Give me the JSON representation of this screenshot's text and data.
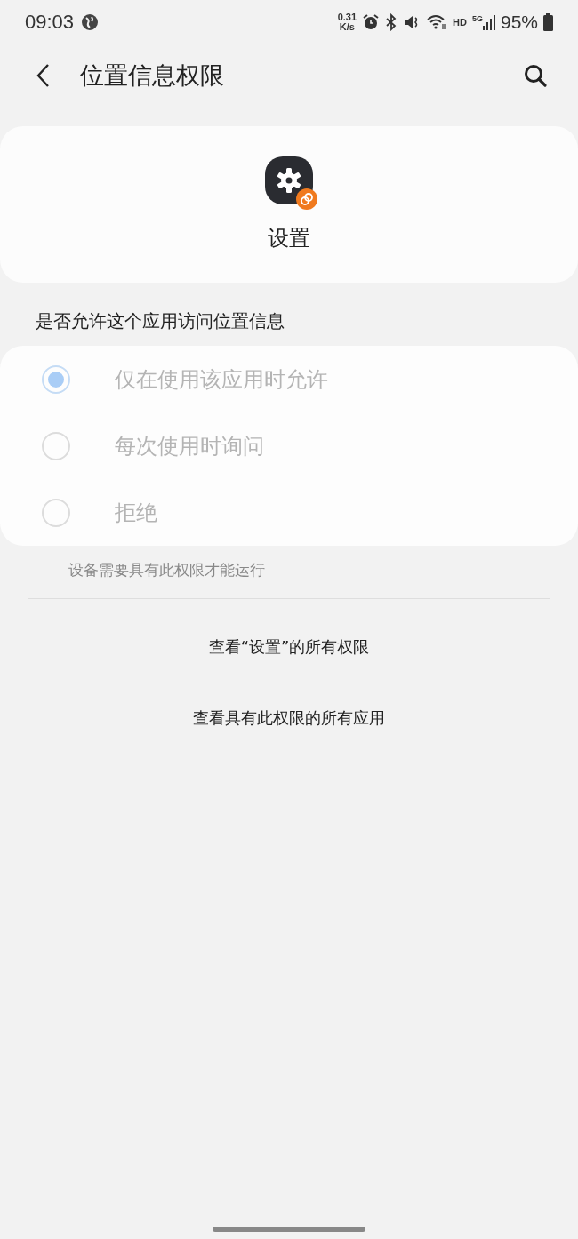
{
  "status_bar": {
    "time": "09:03",
    "net_speed_value": "0.31",
    "net_speed_unit": "K/s",
    "hd": "HD",
    "network": "5G",
    "battery": "95%"
  },
  "header": {
    "title": "位置信息权限"
  },
  "app": {
    "name": "设置"
  },
  "question": "是否允许这个应用访问位置信息",
  "options": [
    {
      "label": "仅在使用该应用时允许",
      "selected": true,
      "disabled": true
    },
    {
      "label": "每次使用时询问",
      "selected": false,
      "disabled": true
    },
    {
      "label": "拒绝",
      "selected": false,
      "disabled": true
    }
  ],
  "note": "设备需要具有此权限才能运行",
  "links": [
    "查看“设置”的所有权限",
    "查看具有此权限的所有应用"
  ]
}
